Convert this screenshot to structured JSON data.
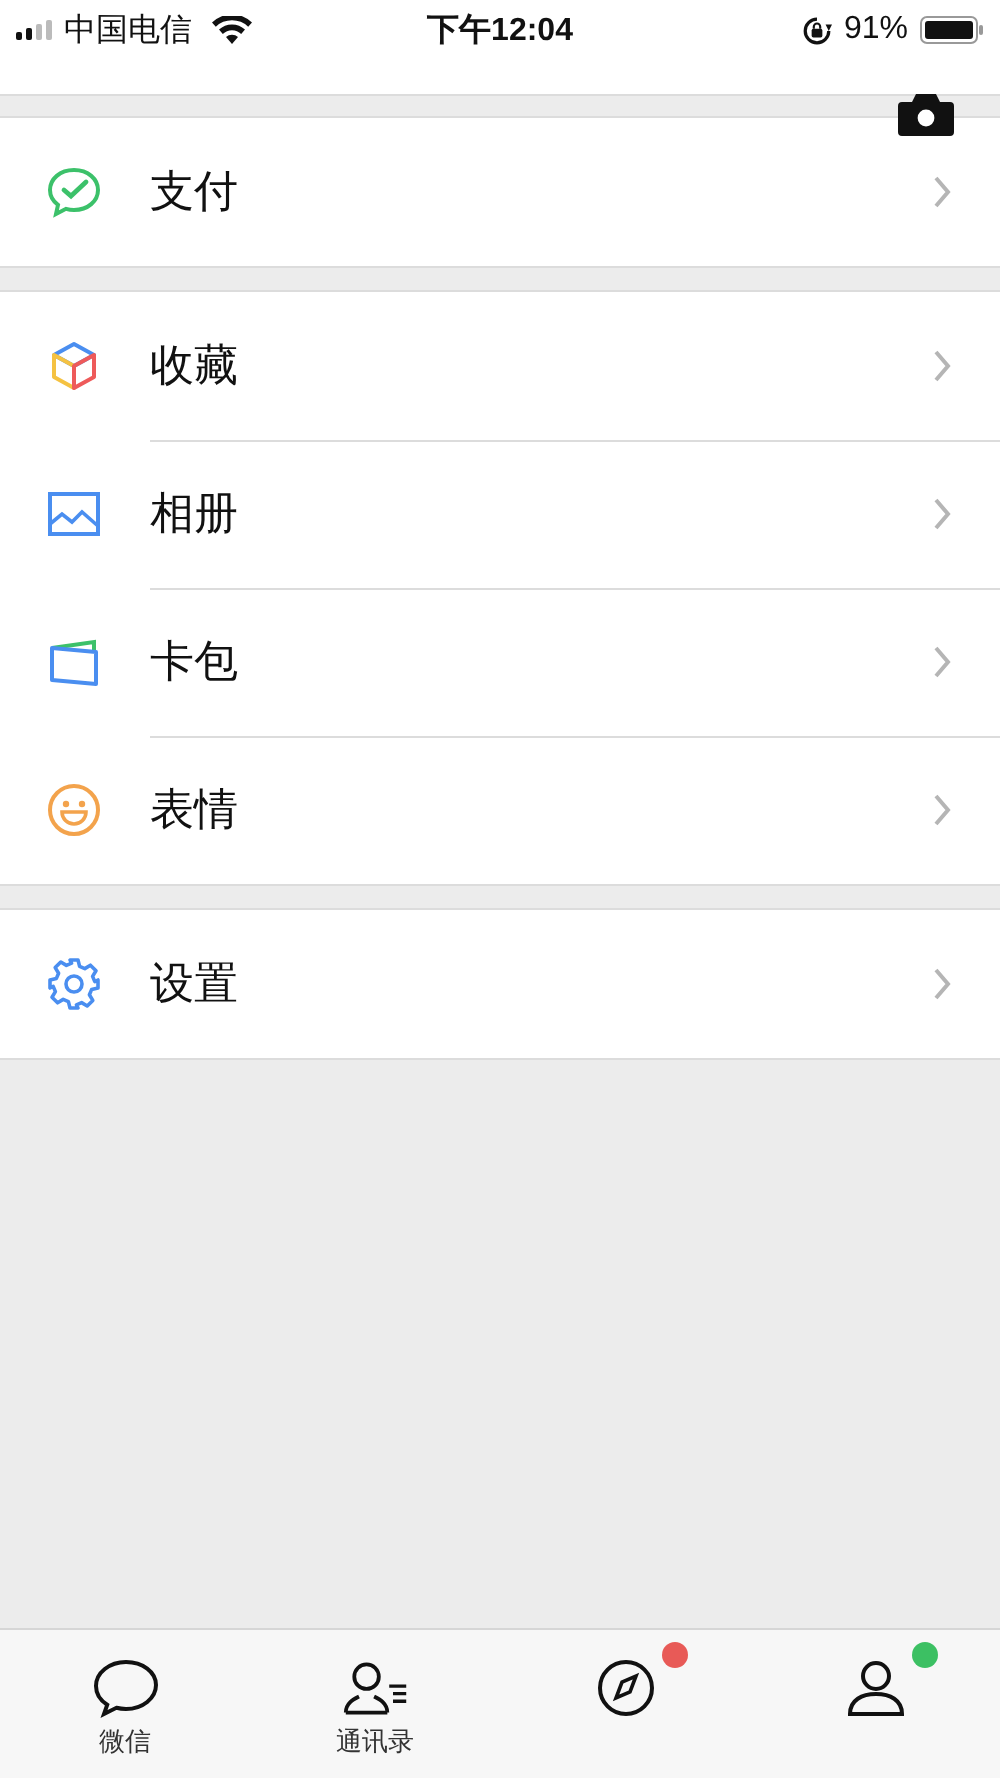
{
  "status_bar": {
    "carrier": "中国电信",
    "time": "下午12:04",
    "battery": "91%"
  },
  "groups": [
    [
      {
        "kind": "pay",
        "label": "支付"
      }
    ],
    [
      {
        "kind": "cube",
        "label": "收藏"
      },
      {
        "kind": "album",
        "label": "相册"
      },
      {
        "kind": "card",
        "label": "卡包"
      },
      {
        "kind": "smile",
        "label": "表情"
      }
    ],
    [
      {
        "kind": "gear",
        "label": "设置"
      }
    ]
  ],
  "tab_bar": [
    {
      "kind": "chat",
      "label": "微信"
    },
    {
      "kind": "contacts",
      "label": "通讯录"
    },
    {
      "kind": "compass",
      "color": "#e85a57"
    },
    {
      "kind": "person",
      "color": "#3cc063"
    }
  ]
}
